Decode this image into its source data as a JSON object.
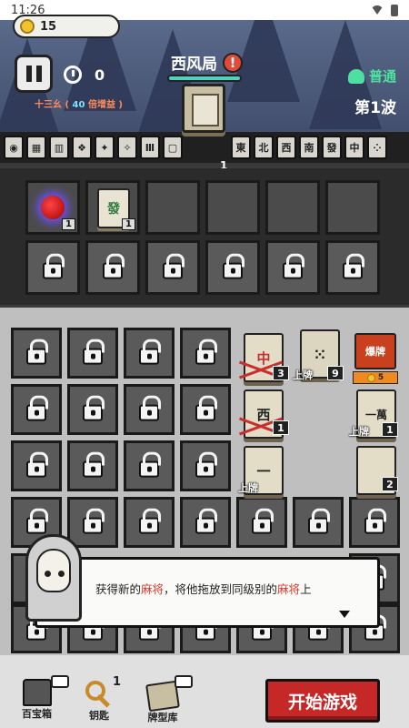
{
  "status_bar": {
    "time": "11:26"
  },
  "hud": {
    "coins": "15",
    "timer": "0",
    "combo_name": "十三幺",
    "combo_open": " ( ",
    "combo_value": "40",
    "combo_mult": "倍增益",
    "combo_close": " )",
    "round_name": "西风局",
    "warning": "!",
    "mode": "普通",
    "wave": "第1波",
    "deck_count": "1"
  },
  "tile_strip": {
    "left": [
      "◉",
      "▦",
      "▥",
      "❖",
      "✦",
      "✧",
      "Ⅲ",
      "▢"
    ],
    "right": [
      "東",
      "北",
      "西",
      "南",
      "發",
      "中",
      "⁘"
    ]
  },
  "equip": {
    "slot1_count": "1",
    "slot2_tile": "發",
    "slot2_count": "1"
  },
  "board": {
    "tile_zhong": "中",
    "tile_zhong_count": "3",
    "tile_bing_count": "9",
    "tile_bing_label": "上牌",
    "bomb_label": "爆牌",
    "bomb_price": "5",
    "tile_xi": "西",
    "tile_xi_count": "1",
    "tile_yiwan": "一萬",
    "tile_yiwan_label": "上牌",
    "tile_yiwan_count": "1",
    "tile_yi": "一",
    "tile_yi_label": "上牌",
    "tile_blank_count": "2"
  },
  "dialog": {
    "text_a": "获得新的",
    "text_hl1": "麻将",
    "text_b": "，将他拖放到同级别的",
    "text_hl2": "麻将",
    "text_c": "上"
  },
  "bottom": {
    "treasure_label": "百宝箱",
    "key_label": "钥匙",
    "key_count": "1",
    "deck_label": "牌型库",
    "start_button": "开始游戏"
  },
  "colors": {
    "start_button": "#c62828",
    "mode_green": "#4ee0a0",
    "highlight_red": "#d03c2c"
  }
}
